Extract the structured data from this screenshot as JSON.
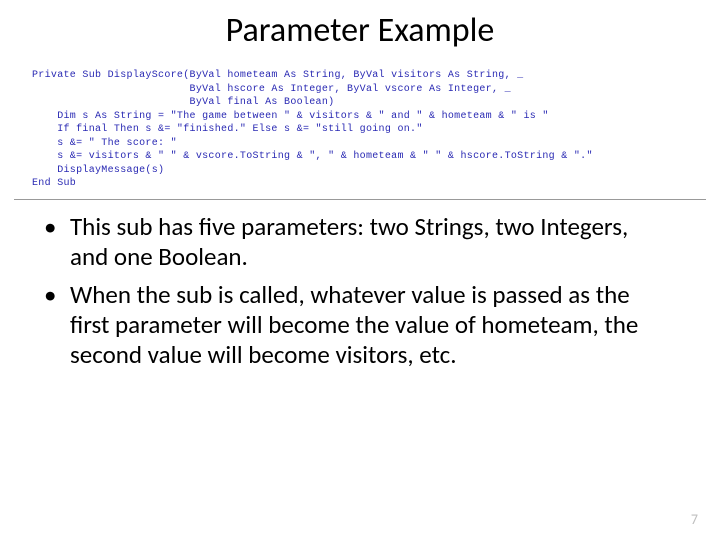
{
  "title": "Parameter Example",
  "code": {
    "l1": "Private Sub DisplayScore(ByVal hometeam As String, ByVal visitors As String, _",
    "l2": "                         ByVal hscore As Integer, ByVal vscore As Integer, _",
    "l3": "                         ByVal final As Boolean)",
    "l4": "    Dim s As String = \"The game between \" & visitors & \" and \" & hometeam & \" is \"",
    "l5": "    If final Then s &= \"finished.\" Else s &= \"still going on.\"",
    "l6": "    s &= \" The score: \"",
    "l7": "    s &= visitors & \" \" & vscore.ToString & \", \" & hometeam & \" \" & hscore.ToString & \".\"",
    "l8": "    DisplayMessage(s)",
    "l9": "End Sub"
  },
  "bullets": [
    "This sub has five parameters: two Strings, two Integers, and one Boolean.",
    "When the sub is called, whatever value is passed as the first parameter will become the value of hometeam, the second value will become visitors, etc."
  ],
  "page_number": "7"
}
